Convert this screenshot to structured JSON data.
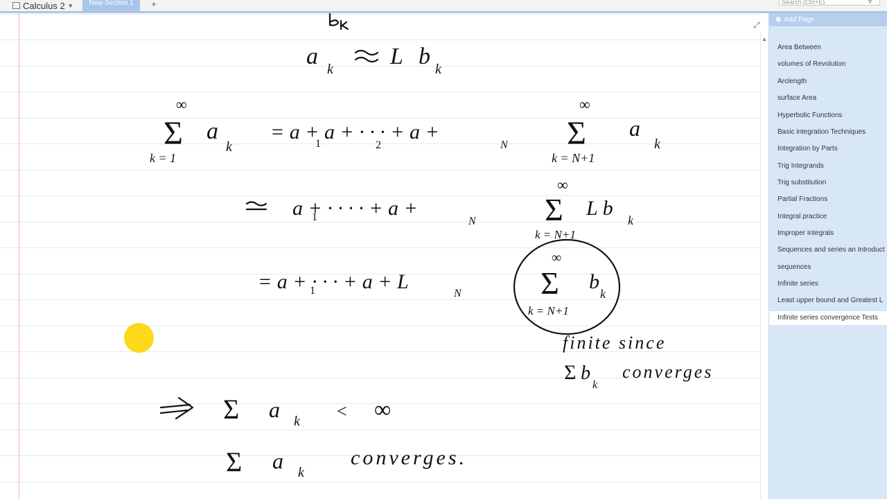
{
  "notebook": {
    "name": "Calculus 2"
  },
  "sections": {
    "active": "New Section 1",
    "add_symbol": "+"
  },
  "search": {
    "placeholder": "Search (Ctrl+E)"
  },
  "panel": {
    "add_page_label": "Add Page",
    "pages": [
      "Area Between",
      "volumes of Revolution",
      "Arclength",
      "surface Area",
      "Hyperbolic Functions",
      "Basic integration Techniques",
      "Integration by Parts",
      "Trig Integrands",
      "Trig substitution",
      "Partial Fractions",
      "Integral practice",
      "Improper Integrals",
      "Sequences and series an Introduct",
      "sequences",
      "Infinite series",
      "Least upper bound and Greatest L",
      "Infinite series convergence Tests"
    ],
    "active_index": 16
  },
  "ink": {
    "line1": "a_k ≈ L b_k",
    "line2": "Σ(k=1..∞) a_k = a_1 + a_2 + ··· + a_N + Σ(k=N+1..∞) a_k",
    "line3": "≈ a_1 + ···· + a_N + Σ(k=N+1..∞) L b_k",
    "line4": "= a_1 + ··· + a_N + L Σ(k=N+1..∞) b_k",
    "note1": "finite since",
    "note2": "Σ b_k converges",
    "line5": "⇒ Σ a_k < ∞",
    "line6": "Σ a_k converges."
  }
}
